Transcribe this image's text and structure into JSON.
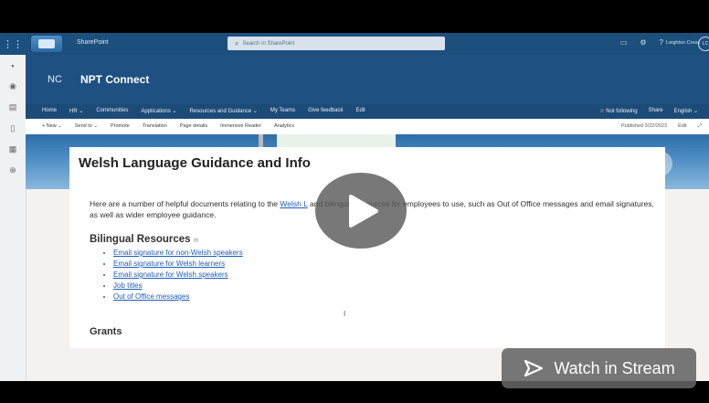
{
  "topbar": {
    "app_name": "SharePoint",
    "search_placeholder": "Search in SharePoint",
    "user_name": "Leighton Cross",
    "avatar_initials": "LC"
  },
  "site": {
    "logo_text": "NC",
    "name": "NPT Connect"
  },
  "nav": {
    "items": [
      "Home",
      "HR ⌄",
      "Communities",
      "Applications ⌄",
      "Resources and Guidance ⌄",
      "My Teams",
      "Give feedback",
      "Edit"
    ],
    "right": [
      "☆ Not following",
      "Share",
      "English ⌄"
    ]
  },
  "cmdbar": {
    "items": [
      "+ New ⌄",
      "Send to ⌄",
      "Promote",
      "Translation",
      "Page details",
      "Immersive Reader",
      "Analytics"
    ],
    "published": "Published 3/22/2023",
    "edit": "Edit"
  },
  "page": {
    "title": "Welsh Language Guidance and Info",
    "intro_before_link": "Here are a number of helpful documents relating to the ",
    "intro_link": "Welsh L",
    "intro_after_link": " and bilingual resources for employees to use, such as Out of Office messages and email signatures, as well as wider employee guidance.",
    "section_bilingual": "Bilingual Resources",
    "resources": [
      "Email signature for non-Welsh speakers",
      "Email signature for Welsh learners",
      "Email signature for Welsh speakers",
      "Job titles",
      "Out of Office messages"
    ],
    "section_grants": "Grants"
  },
  "video": {
    "watch_label": "Watch in Stream"
  },
  "colors": {
    "suite_bar": "#1d4f7c",
    "header": "#1f5082",
    "link": "#1f5eb8",
    "flag_red": "#d91f2d",
    "flag_green": "#0f8a3a"
  },
  "icons": [
    "waffle-icon",
    "search-icon",
    "chat-icon",
    "settings-icon",
    "help-icon",
    "play-icon",
    "stream-icon"
  ]
}
